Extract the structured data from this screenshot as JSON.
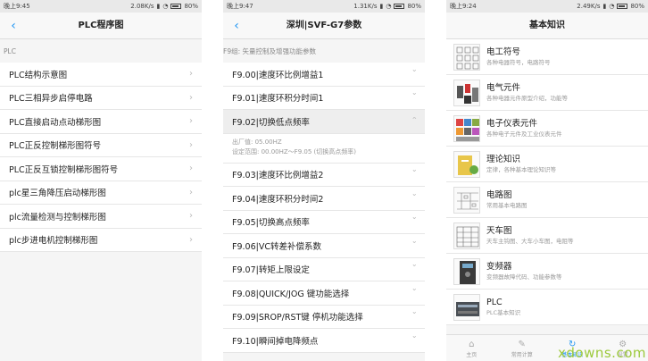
{
  "screen1": {
    "status": {
      "time": "晚上9:45",
      "speed": "2.08K/s",
      "battery": "80%"
    },
    "title": "PLC程序图",
    "section": "PLC",
    "items": [
      "PLC结构示意图",
      "PLC三相异步启停电路",
      "PLC直接启动点动梯形图",
      "PLC正反控制梯形图符号",
      "PLC正反互锁控制梯形图符号",
      "plc星三角降压启动梯形图",
      "plc流量检测与控制梯形图",
      "plc步进电机控制梯形图"
    ]
  },
  "screen2": {
    "status": {
      "time": "晚上9:47",
      "speed": "1.31K/s",
      "battery": "80%"
    },
    "title": "深圳|SVF-G7参数",
    "section": "F9组: 矢量控制及增强功能参数",
    "items": [
      "F9.00|速度环比例增益1",
      "F9.01|速度环积分时间1",
      "F9.02|切换低点频率"
    ],
    "expanded_detail": {
      "line1": "出厂值: 05.00HZ",
      "line2": "设定范围: 00.00HZ～F9.05 (切换高点频率)"
    },
    "items_after": [
      "F9.03|速度环比例增益2",
      "F9.04|速度环积分时间2",
      "F9.05|切换高点频率",
      "F9.06|VC转差补偿系数",
      "F9.07|转矩上限设定",
      "F9.08|QUICK/JOG 键功能选择",
      "F9.09|SROP/RST键 停机功能选择",
      "F9.10|瞬间掉电降频点"
    ]
  },
  "screen3": {
    "status": {
      "time": "晚上9:24",
      "speed": "2.49K/s",
      "battery": "80%"
    },
    "title": "基本知识",
    "items": [
      {
        "title": "电工符号",
        "sub": "各种电器符号，电路符号"
      },
      {
        "title": "电气元件",
        "sub": "各种电器元件原型介绍，功能等"
      },
      {
        "title": "电子仪表元件",
        "sub": "各种电子元件及工业仪表元件"
      },
      {
        "title": "理论知识",
        "sub": "定律，各种基本理论知识等"
      },
      {
        "title": "电路图",
        "sub": "常用基本电路图"
      },
      {
        "title": "天车图",
        "sub": "天车主钩图、大车小车图，电阻等"
      },
      {
        "title": "变频器",
        "sub": "变频器故障代码、功能参数等"
      },
      {
        "title": "PLC",
        "sub": "PLC基本知识"
      }
    ],
    "tabs": [
      "主页",
      "常用计算",
      "基本知识",
      "设置"
    ]
  },
  "watermark": "xdowns.com"
}
